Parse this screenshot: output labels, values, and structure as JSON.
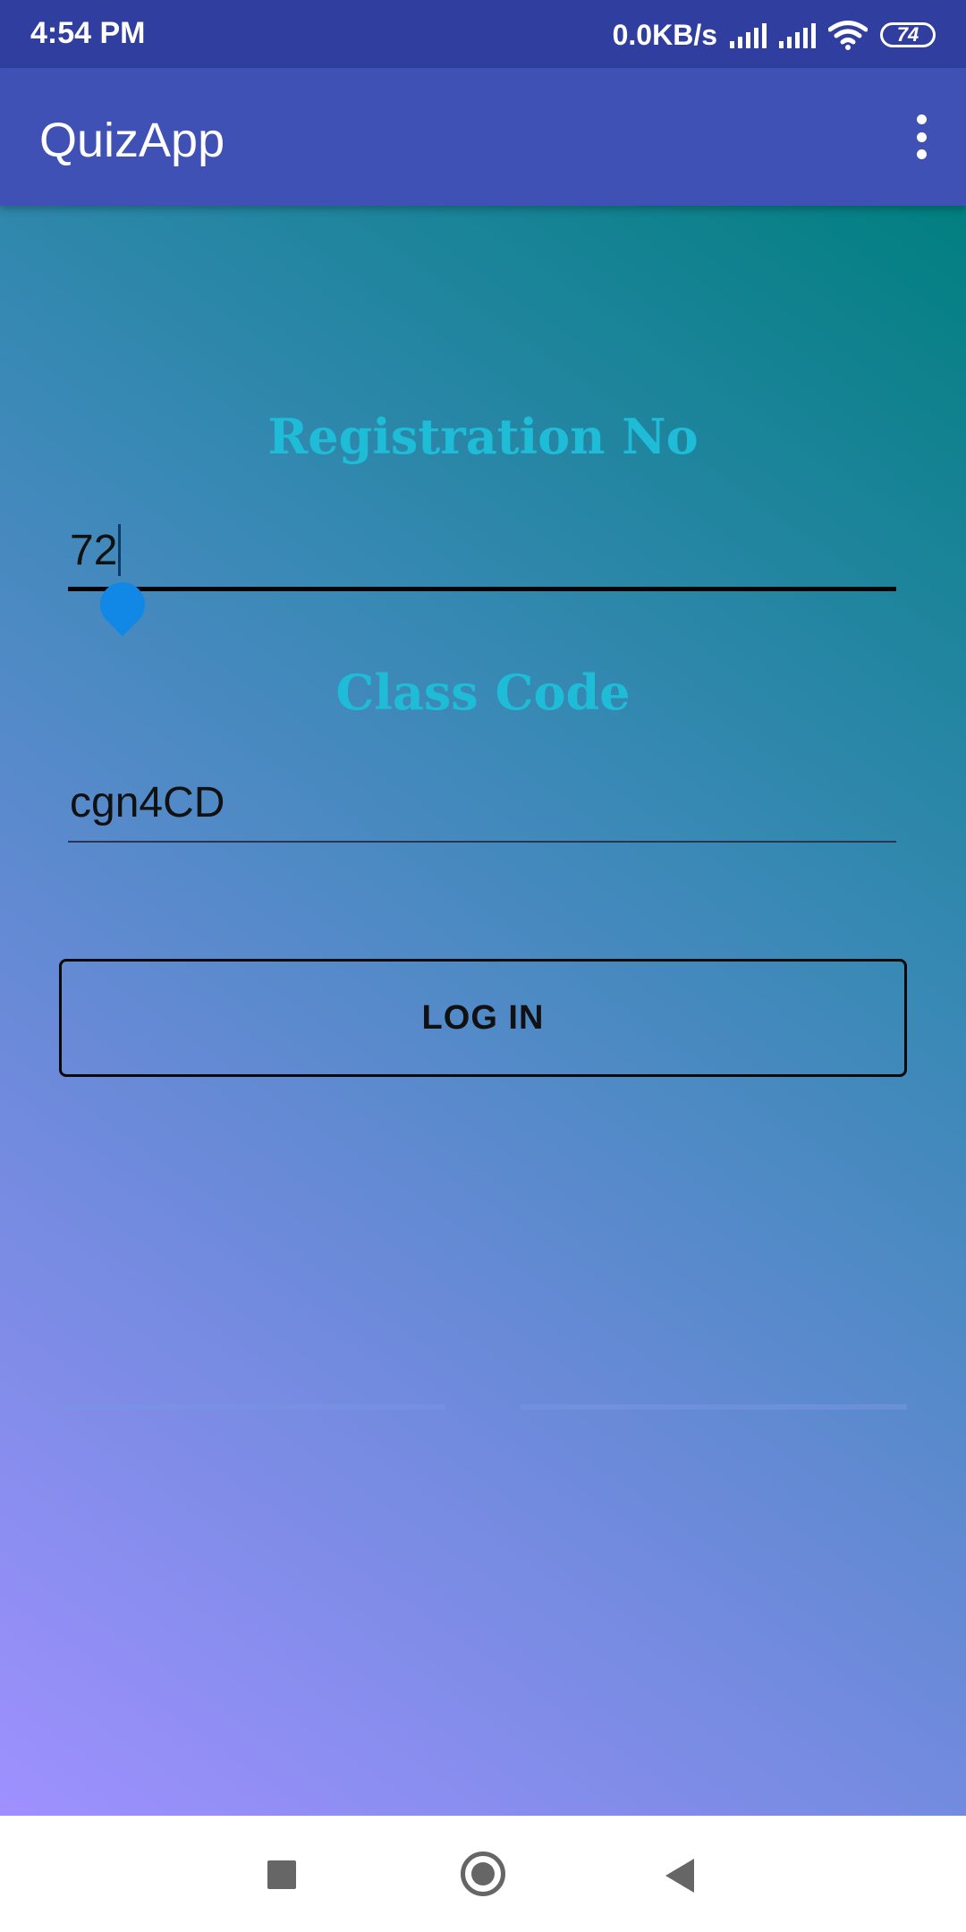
{
  "status_bar": {
    "time": "4:54 PM",
    "net_speed": "0.0KB/s",
    "battery": "74"
  },
  "app_bar": {
    "title": "QuizApp",
    "menu_icon": "more-vert-icon"
  },
  "form": {
    "registration_label": "Registration No",
    "registration_value": "72",
    "class_code_label": "Class Code",
    "class_code_value": "cgn4CD",
    "login_label": "LOG IN"
  },
  "colors": {
    "status_bar": "#303f9f",
    "app_bar": "#3f51b5",
    "heading": "#1fbcd8",
    "gradient_top": "#017f80",
    "gradient_bottom": "#9f90ff",
    "cursor_handle": "#1187e6"
  },
  "nav_bar": {
    "recents_icon": "square-icon",
    "home_icon": "circle-icon",
    "back_icon": "back-triangle-icon"
  }
}
